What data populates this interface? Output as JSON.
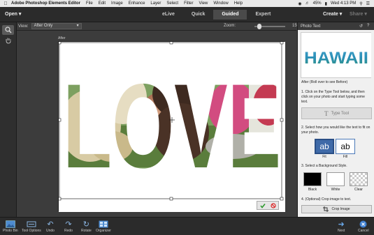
{
  "menubar": {
    "app_name": "Adobe Photoshop Elements Editor",
    "menus": [
      "File",
      "Edit",
      "Image",
      "Enhance",
      "Layer",
      "Select",
      "Filter",
      "View",
      "Window",
      "Help"
    ],
    "battery": "45%",
    "clock": "Wed 4:13 PM"
  },
  "topbar": {
    "open_label": "Open",
    "modes": [
      "eLive",
      "Quick",
      "Guided",
      "Expert"
    ],
    "active_mode": "Guided",
    "create_label": "Create",
    "share_label": "Share"
  },
  "options": {
    "view_label": "View:",
    "view_value": "After Only",
    "zoom_label": "Zoom:",
    "zoom_value": "15%",
    "zoom_fraction": 0.15
  },
  "document": {
    "title": "After",
    "text_layer": "LOVE"
  },
  "panel": {
    "title": "Photo Text",
    "preview_text": "HAWAII",
    "after_caption": "After (Roll over to see Before)",
    "step1": "1. Click on the Type Tool below, and then click on your photo and start typing some text.",
    "type_tool_label": "Type Tool",
    "step2": "2. Select how you would like the text to fit on your photo.",
    "fit_options": [
      "Fit",
      "Fill"
    ],
    "fit_glyph": "ab",
    "step3": "3. Select a Background Style.",
    "backgrounds": [
      "Black",
      "White",
      "Clear"
    ],
    "step4": "4. (Optional) Crop image to text.",
    "crop_label": "Crop Image"
  },
  "bottombar": {
    "items": [
      "Photo Bin",
      "Tool Options",
      "Undo",
      "Redo",
      "Rotate",
      "Organizer"
    ],
    "next_label": "Next",
    "cancel_label": "Cancel"
  },
  "colors": {
    "accent_blue": "#3f6aa8",
    "commit_green": "#2e9a2e",
    "cancel_red": "#d22"
  }
}
